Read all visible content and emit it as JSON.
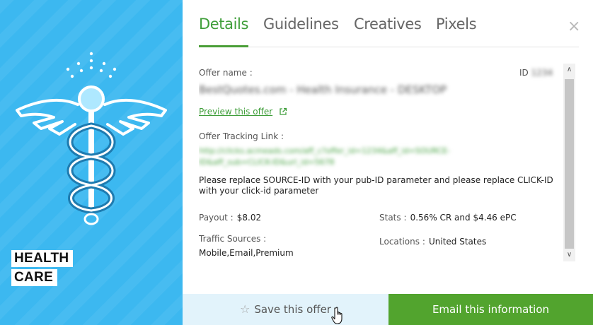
{
  "category": {
    "line1": "HEALTH",
    "line2": "CARE"
  },
  "tabs": [
    {
      "label": "Details",
      "active": true
    },
    {
      "label": "Guidelines",
      "active": false
    },
    {
      "label": "Creatives",
      "active": false
    },
    {
      "label": "Pixels",
      "active": false
    }
  ],
  "close_label": "×",
  "details": {
    "offer_name_label": "Offer name :",
    "offer_name_value": "BestQuotes.com - Health Insurance - DESKTOP",
    "id_label": "ID",
    "id_value": "1234",
    "preview_link": "Preview this offer",
    "tracking_label": "Offer Tracking Link :",
    "tracking_value": "http://clicks.acmeads.com/aff_c?offer_id=1234&aff_id=SOURCE-ID&aff_sub=CLICK-ID&url_id=5678",
    "note": "Please replace SOURCE-ID with your pub-ID parameter and please replace CLICK-ID with your click-id parameter",
    "payout_label": "Payout :",
    "payout_value": "$8.02",
    "stats_label": "Stats :",
    "stats_value": "0.56% CR and $4.46 ePC",
    "traffic_label": "Traffic Sources :",
    "traffic_value": "Mobile,Email,Premium",
    "locations_label": "Locations :",
    "locations_value": "United States"
  },
  "footer": {
    "save_label": "Save this offer",
    "email_label": "Email this information"
  },
  "icons": {
    "star": "star-outline-icon",
    "external": "external-link-icon",
    "close": "close-icon",
    "caduceus": "caduceus-icon"
  },
  "colors": {
    "left_panel": "#3cb8f0",
    "accent_green": "#3f9e3a",
    "email_button": "#52a42e",
    "save_button": "#e2f3fb"
  }
}
